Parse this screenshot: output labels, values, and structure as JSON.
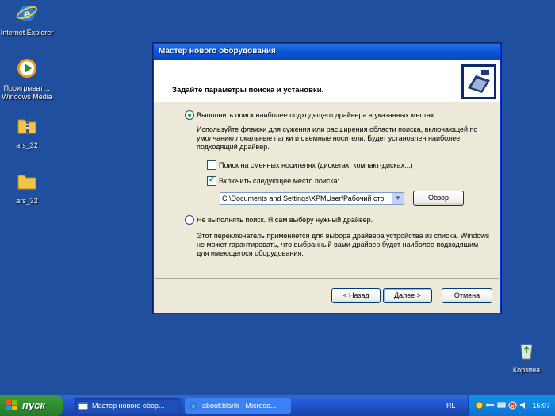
{
  "desktop": {
    "icons": [
      {
        "label": "Internet Explorer",
        "icon": "ie-icon"
      },
      {
        "label": "Проигрыват… Windows Media",
        "icon": "media-player-icon"
      },
      {
        "label": "ars_32",
        "icon": "zip-folder-icon"
      },
      {
        "label": "ars_32",
        "icon": "folder-icon"
      },
      {
        "label": "Корзина",
        "icon": "recycle-bin-icon"
      }
    ]
  },
  "window": {
    "title": "Мастер нового оборудования",
    "header_title": "Задайте параметры поиска и установки.",
    "options": {
      "search": {
        "label": "Выполнить поиск наиболее подходящего драйвера в указанных местах.",
        "selected": true,
        "description": "Используйте флажки для сужения или расширения области поиска, включающей по умолчанию локальные папки и съемные носители. Будет установлен наиболее подходящий драйвер.",
        "removable_label": "Поиск на сменных носителях (дискетах, компакт-дисках...)",
        "removable_checked": false,
        "include_label": "Включить следующее место поиска:",
        "include_checked": true,
        "path_value": "C:\\Documents and Settings\\XPMUser\\Рабочий сто",
        "browse_label": "Обзор"
      },
      "no_search": {
        "label": "Не выполнять поиск. Я сам выберу нужный драйвер.",
        "selected": false,
        "description": "Этот переключатель применяется для выбора драйвера устройства из списка. Windows не может гарантировать, что выбранный вами драйвер будет наиболее подходящим для имеющегося оборудования."
      }
    },
    "buttons": {
      "back": "< Назад",
      "next": "Далее >",
      "cancel": "Отмена"
    }
  },
  "taskbar": {
    "start_label": "пуск",
    "tasks": [
      {
        "label": "Мастер нового обор...",
        "active": true
      },
      {
        "label": "about:blank - Microso...",
        "active": false
      }
    ],
    "language": "RL",
    "clock": "15:07"
  },
  "colors": {
    "desktop": "#1f4f9e",
    "titlebar": "#0a57d5",
    "taskbar": "#245edb",
    "start": "#2f8a2f"
  }
}
